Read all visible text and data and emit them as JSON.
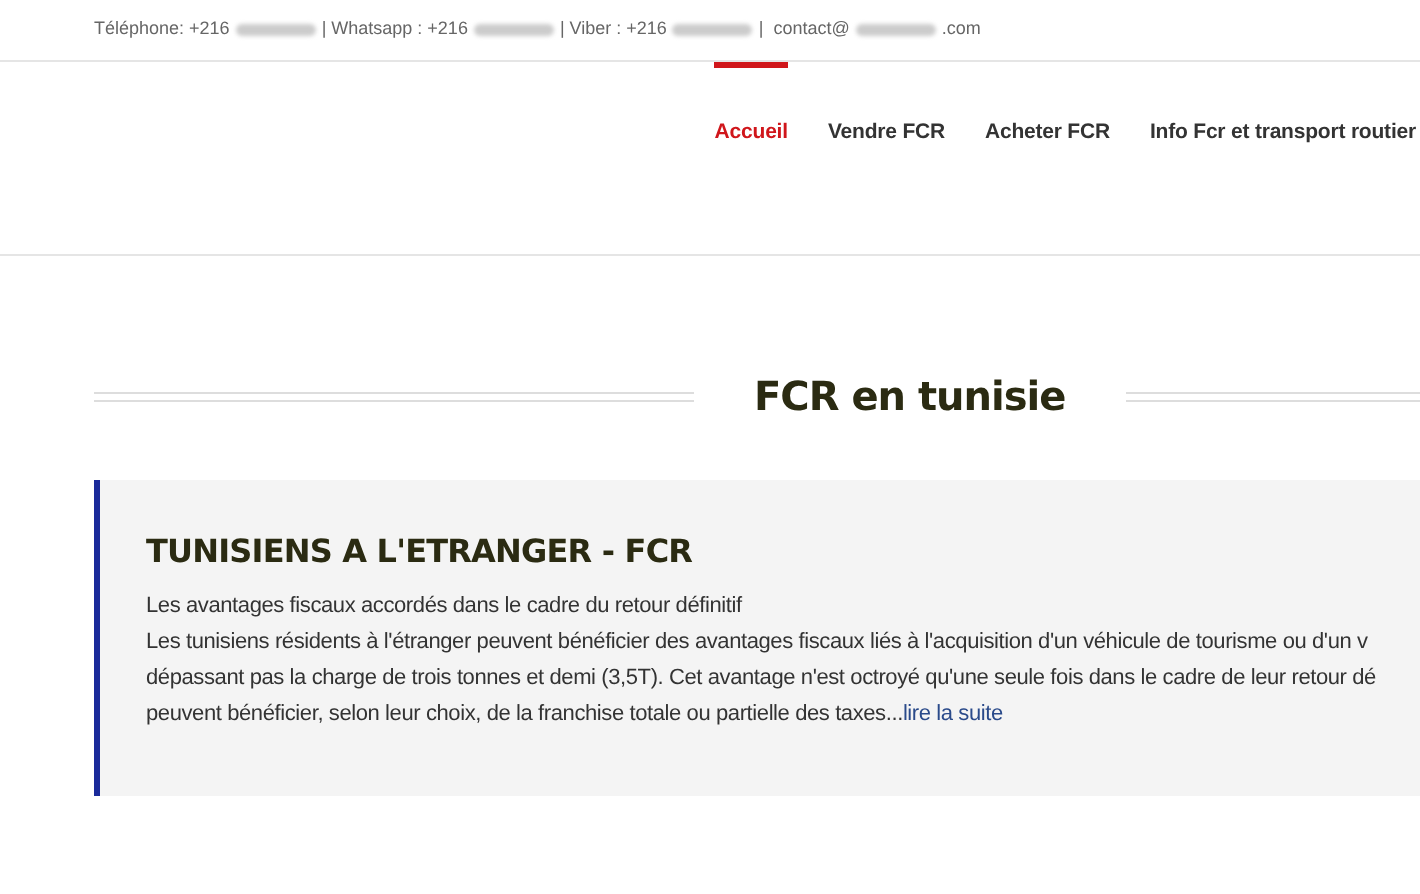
{
  "top_bar": {
    "items": [
      {
        "kind": "text",
        "text": "Téléphone: +216"
      },
      {
        "kind": "redacted"
      },
      {
        "kind": "text",
        "text": "| Whatsapp : +216"
      },
      {
        "kind": "redacted"
      },
      {
        "kind": "text",
        "text": "| Viber : +216"
      },
      {
        "kind": "redacted"
      },
      {
        "kind": "text",
        "text": "|  contact@"
      },
      {
        "kind": "redacted"
      },
      {
        "kind": "text",
        "text": ".com"
      }
    ]
  },
  "nav": [
    {
      "label": "Accueil",
      "selected": true
    },
    {
      "label": "Vendre FCR",
      "selected": false
    },
    {
      "label": "Acheter FCR",
      "selected": false
    },
    {
      "label": "Info Fcr et transport routier",
      "selected": false
    }
  ],
  "section_title": "FCR en tunisie",
  "card": {
    "title": "TUNISIENS A L'ETRANGER - FCR",
    "lines": [
      "Les avantages fiscaux accordés dans le cadre du retour définitif",
      "Les tunisiens résidents à l'étranger peuvent bénéficier des avantages fiscaux liés à l'acquisition d'un véhicule de tourisme ou d'un v",
      "dépassant pas la charge de trois tonnes et demi (3,5T). Cet avantage n'est octroyé qu'une seule fois dans le cadre de leur retour dé",
      "peuvent bénéficier, selon leur choix, de la franchise totale ou partielle des taxes..."
    ],
    "link": "lire la suite"
  }
}
